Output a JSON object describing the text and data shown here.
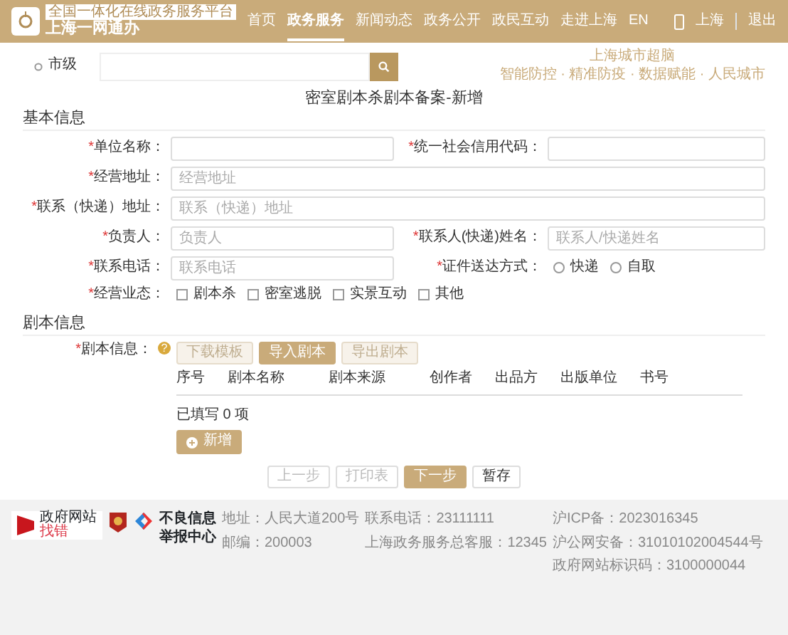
{
  "header": {
    "tagline": "全国一体化在线政务服务平台",
    "logo_text": "上海一网通办",
    "nav": [
      {
        "label": "首页",
        "selected": false
      },
      {
        "label": "政务服务",
        "selected": true
      },
      {
        "label": "新闻动态",
        "selected": false
      },
      {
        "label": "政务公开",
        "selected": false
      },
      {
        "label": "政民互动",
        "selected": false
      },
      {
        "label": "走进上海",
        "selected": false
      },
      {
        "label": "EN",
        "selected": false
      }
    ],
    "city": "上海",
    "logout": "退出"
  },
  "search": {
    "level": "市级",
    "promo_title": "上海城市超脑",
    "promo_sub": "智能防控 · 精准防疫 · 数据赋能 · 人民城市"
  },
  "form": {
    "title": "密室剧本杀剧本备案-新增",
    "sections": [
      {
        "title": "基本信息",
        "rows": [
          [
            {
              "kind": "input",
              "mark": "*",
              "label": "单位名称："
            },
            {
              "kind": "input",
              "mark": "*",
              "label": "统一社会信用代码："
            }
          ],
          [
            {
              "kind": "input",
              "mark": "*",
              "label": "经营地址：",
              "placeholder": "经营地址",
              "wide": true
            }
          ],
          [
            {
              "kind": "input",
              "mark": "*",
              "label": "联系（快递）地址：",
              "placeholder": "联系（快递）地址",
              "wide": true
            }
          ],
          [
            {
              "kind": "input",
              "mark": "*",
              "label": "负责人：",
              "placeholder": "负责人"
            },
            {
              "kind": "input",
              "mark": "*",
              "label": "联系人(快递)姓名：",
              "placeholder": "联系人/快递姓名"
            }
          ],
          [
            {
              "kind": "input",
              "mark": "*",
              "label": "联系电话：",
              "placeholder": "联系电话"
            },
            {
              "kind": "radio",
              "mark": "*",
              "label": "证件送达方式：",
              "options": [
                {
                  "label": "快递",
                  "selected": false
                },
                {
                  "label": "自取",
                  "selected": false
                }
              ]
            }
          ],
          [
            {
              "kind": "checkbox",
              "mark": "*",
              "label": "经营业态：",
              "options": [
                {
                  "label": "剧本杀",
                  "checked": false
                },
                {
                  "label": "密室逃脱",
                  "checked": false
                },
                {
                  "label": "实景互动",
                  "checked": false
                },
                {
                  "label": "其他",
                  "checked": false
                }
              ]
            }
          ]
        ]
      }
    ],
    "script_section": {
      "title": "剧本信息",
      "mark": "*",
      "label": "剧本信息：",
      "help": "?",
      "buttons": [
        {
          "label": "下载模板",
          "primary": false
        },
        {
          "label": "导入剧本",
          "primary": true
        },
        {
          "label": "导出剧本",
          "primary": false
        }
      ],
      "columns": [
        "序号",
        "剧本名称",
        "剧本来源",
        "创作者",
        "出品方",
        "出版单位",
        "书号"
      ],
      "count_text": "已填写 0 项",
      "add_button": "新增"
    },
    "actions": [
      {
        "label": "上一步",
        "kind": "muted"
      },
      {
        "label": "打印表",
        "kind": "muted"
      },
      {
        "label": "下一步",
        "kind": "primary"
      },
      {
        "label": "暂存",
        "kind": "plain"
      }
    ]
  },
  "footer": {
    "find_error_top": "政府网站",
    "find_error_bottom": "找错",
    "report_top": "不良信息",
    "report_bottom": "举报中心",
    "info_columns": [
      [
        "地址：人民大道200号",
        "邮编：200003"
      ],
      [
        "联系电话：23111111",
        "上海政务服务总客服：12345"
      ],
      [
        "沪ICP备：2023016345",
        "沪公网安备：31010102004544号",
        "政府网站标识码：3100000044"
      ]
    ]
  }
}
